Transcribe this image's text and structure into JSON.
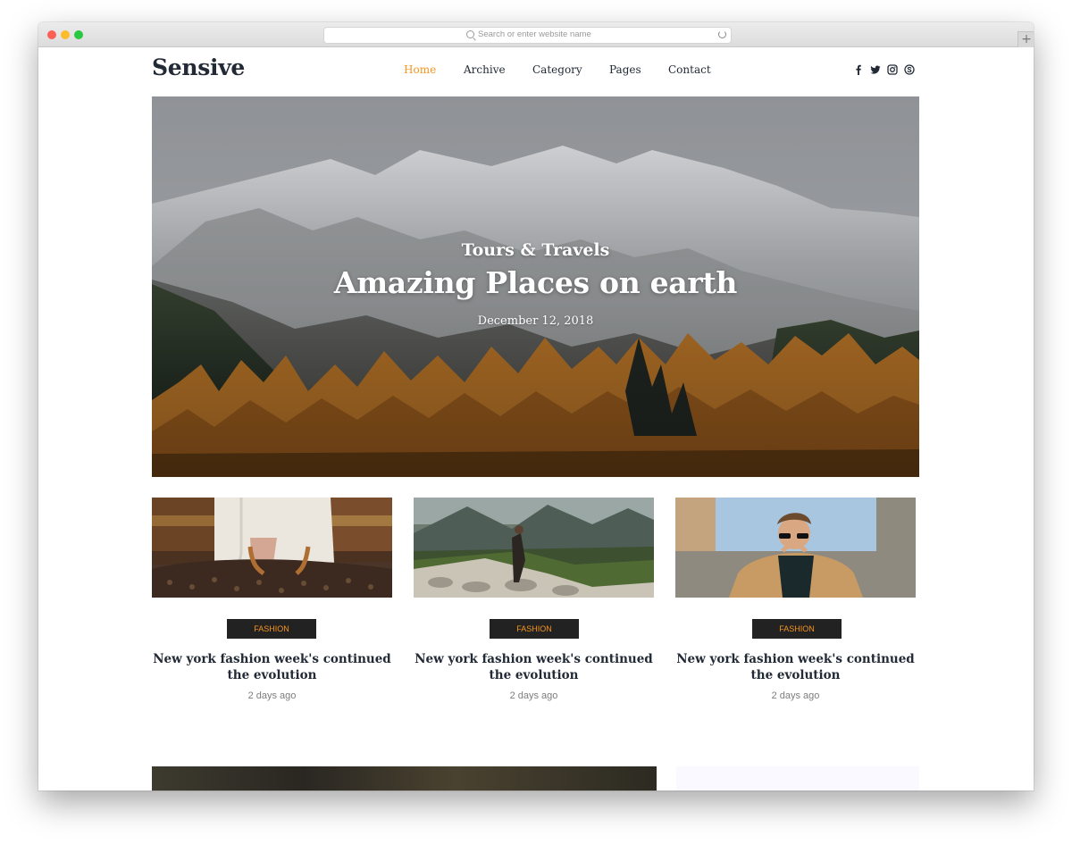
{
  "browser": {
    "url_placeholder": "Search or enter website name",
    "new_tab_label": "+"
  },
  "site": {
    "logo": "Sensive",
    "accent_color": "#f7941d",
    "nav": [
      {
        "label": "Home",
        "active": true
      },
      {
        "label": "Archive",
        "active": false
      },
      {
        "label": "Category",
        "active": false
      },
      {
        "label": "Pages",
        "active": false
      },
      {
        "label": "Contact",
        "active": false
      }
    ],
    "social_icons": [
      "facebook-icon",
      "twitter-icon",
      "instagram-icon",
      "skype-icon"
    ]
  },
  "hero": {
    "category": "Tours & Travels",
    "title": "Amazing Places on earth",
    "date": "December 12, 2018"
  },
  "cards": [
    {
      "badge": "Fashion",
      "title": "New york fashion week's continued the evolution",
      "time": "2 days ago"
    },
    {
      "badge": "Fashion",
      "title": "New york fashion week's continued the evolution",
      "time": "2 days ago"
    },
    {
      "badge": "Fashion",
      "title": "New york fashion week's continued the evolution",
      "time": "2 days ago"
    }
  ]
}
